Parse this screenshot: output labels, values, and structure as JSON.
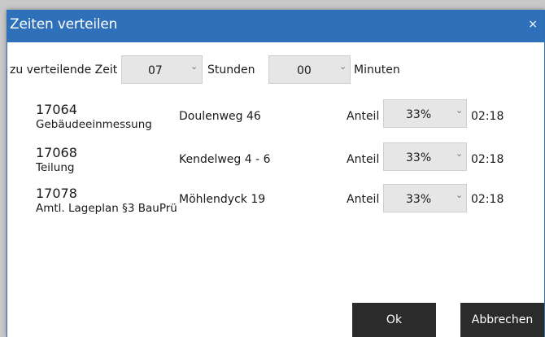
{
  "dialog": {
    "title": "Zeiten verteilen",
    "close_glyph": "×"
  },
  "time": {
    "label": "zu verteilende Zeit",
    "hours_value": "07",
    "hours_unit": "Stunden",
    "minutes_value": "00",
    "minutes_unit": "Minuten"
  },
  "jobs": [
    {
      "number": "17064",
      "description": "Gebäudeeinmessung",
      "address": "Doulenweg 46",
      "share_label": "Anteil",
      "share": "33%",
      "time": "02:18"
    },
    {
      "number": "17068",
      "description": "Teilung",
      "address": "Kendelweg 4 - 6",
      "share_label": "Anteil",
      "share": "33%",
      "time": "02:18"
    },
    {
      "number": "17078",
      "description": "Amtl. Lageplan §3 BauPrü",
      "address": "Möhlendyck 19",
      "share_label": "Anteil",
      "share": "33%",
      "time": "02:18"
    }
  ],
  "buttons": {
    "ok": "Ok",
    "cancel": "Abbrechen"
  },
  "icons": {
    "dropdown": "chevron-down-icon",
    "close": "close-icon"
  },
  "colors": {
    "titlebar": "#2e70b9",
    "dropdown_bg": "#e6e6e6",
    "button_bg": "#2b2b2b"
  }
}
